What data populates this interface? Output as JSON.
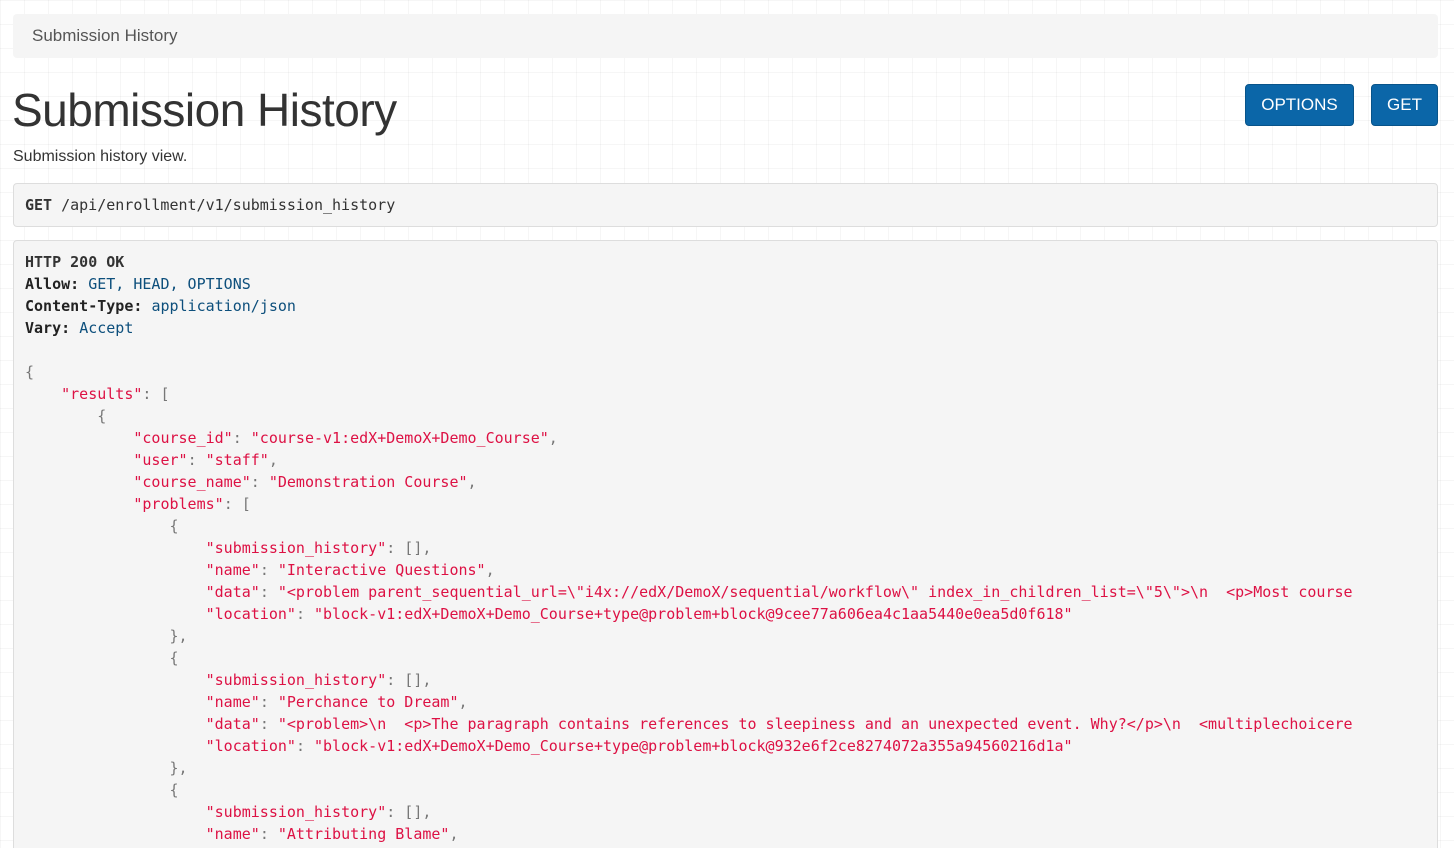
{
  "breadcrumb": {
    "items": [
      "Submission History"
    ]
  },
  "header": {
    "title": "Submission History",
    "description": "Submission history view."
  },
  "buttons": {
    "options_label": "OPTIONS",
    "get_label": "GET"
  },
  "request": {
    "method": "GET",
    "path": "/api/enrollment/v1/submission_history"
  },
  "response": {
    "status": "HTTP 200 OK",
    "headers": [
      {
        "name": "Allow:",
        "value": "GET, HEAD, OPTIONS"
      },
      {
        "name": "Content-Type:",
        "value": "application/json"
      },
      {
        "name": "Vary:",
        "value": "Accept"
      }
    ],
    "body_lines": [
      "{",
      "    \"results\": [",
      "        {",
      "            \"course_id\": \"course-v1:edX+DemoX+Demo_Course\",",
      "            \"user\": \"staff\",",
      "            \"course_name\": \"Demonstration Course\",",
      "            \"problems\": [",
      "                {",
      "                    \"submission_history\": [],",
      "                    \"name\": \"Interactive Questions\",",
      "                    \"data\": \"<problem parent_sequential_url=\\\"i4x://edX/DemoX/sequential/workflow\\\" index_in_children_list=\\\"5\\\">\\n  <p>Most course",
      "                    \"location\": \"block-v1:edX+DemoX+Demo_Course+type@problem+block@9cee77a606ea4c1aa5440e0ea5d0f618\"",
      "                },",
      "                {",
      "                    \"submission_history\": [],",
      "                    \"name\": \"Perchance to Dream\",",
      "                    \"data\": \"<problem>\\n  <p>The paragraph contains references to sleepiness and an unexpected event. Why?</p>\\n  <multiplechoicere",
      "                    \"location\": \"block-v1:edX+DemoX+Demo_Course+type@problem+block@932e6f2ce8274072a355a94560216d1a\"",
      "                },",
      "                {",
      "                    \"submission_history\": [],",
      "                    \"name\": \"Attributing Blame\","
    ]
  }
}
